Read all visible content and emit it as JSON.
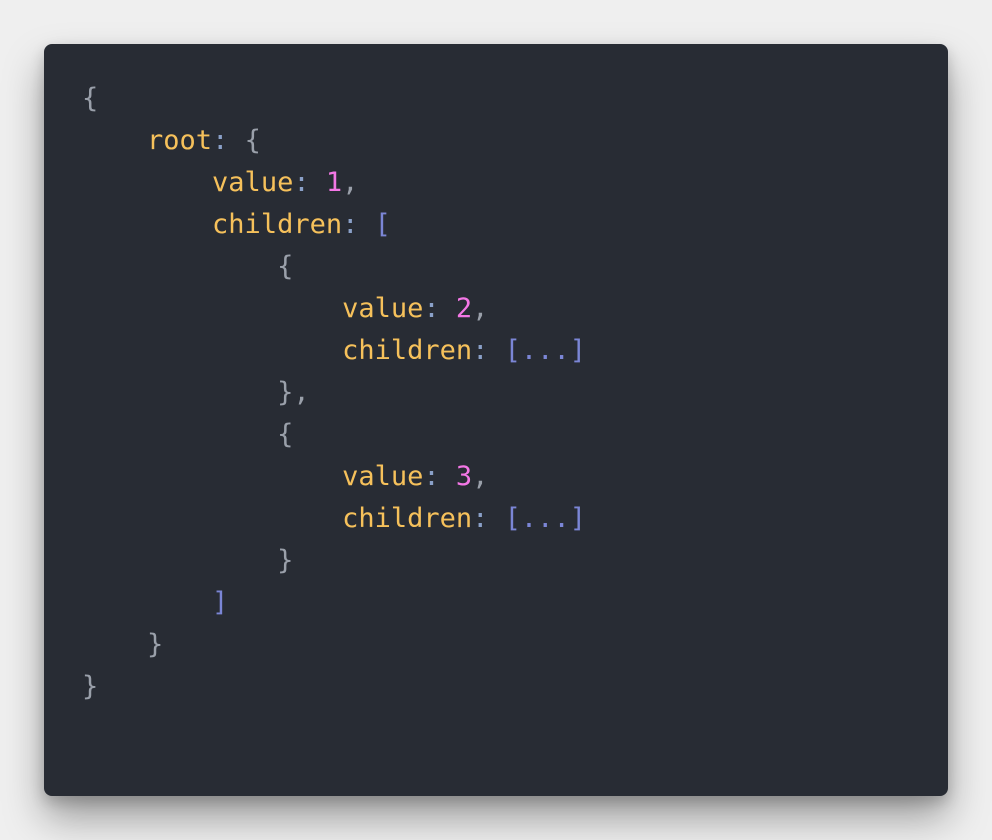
{
  "code": {
    "line1": {
      "brace": "{"
    },
    "line2": {
      "key": "root",
      "colon": ":",
      "brace": "{"
    },
    "line3": {
      "key": "value",
      "colon": ":",
      "num": "1",
      "comma": ","
    },
    "line4": {
      "key": "children",
      "colon": ":",
      "bracket": "["
    },
    "line5": {
      "brace": "{"
    },
    "line6": {
      "key": "value",
      "colon": ":",
      "num": "2",
      "comma": ","
    },
    "line7": {
      "key": "children",
      "colon": ":",
      "bracket": "[...]"
    },
    "line8": {
      "brace": "}",
      "comma": ","
    },
    "line9": {
      "brace": "{"
    },
    "line10": {
      "key": "value",
      "colon": ":",
      "num": "3",
      "comma": ","
    },
    "line11": {
      "key": "children",
      "colon": ":",
      "bracket": "[...]"
    },
    "line12": {
      "brace": "}"
    },
    "line13": {
      "bracket": "]"
    },
    "line14": {
      "brace": "}"
    },
    "line15": {
      "brace": "}"
    }
  },
  "colors": {
    "background": "#282c34",
    "key": "#f6c15b",
    "number": "#f477e6",
    "punctuation": "#9aa0aa",
    "bracket": "#7b86d6"
  }
}
